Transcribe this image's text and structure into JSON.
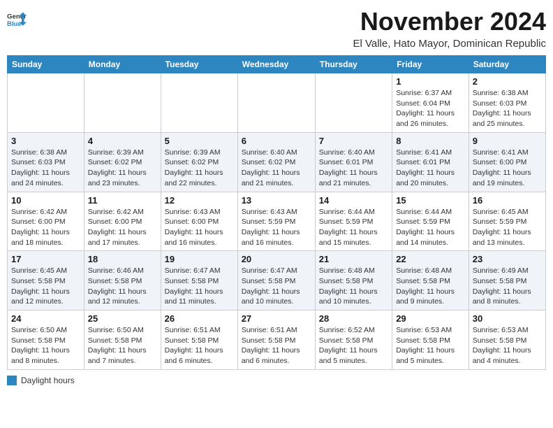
{
  "header": {
    "logo_line1": "General",
    "logo_line2": "Blue",
    "month": "November 2024",
    "location": "El Valle, Hato Mayor, Dominican Republic"
  },
  "days_of_week": [
    "Sunday",
    "Monday",
    "Tuesday",
    "Wednesday",
    "Thursday",
    "Friday",
    "Saturday"
  ],
  "weeks": [
    {
      "cells": [
        {
          "day": null,
          "info": null
        },
        {
          "day": null,
          "info": null
        },
        {
          "day": null,
          "info": null
        },
        {
          "day": null,
          "info": null
        },
        {
          "day": null,
          "info": null
        },
        {
          "day": "1",
          "info": "Sunrise: 6:37 AM\nSunset: 6:04 PM\nDaylight: 11 hours and 26 minutes."
        },
        {
          "day": "2",
          "info": "Sunrise: 6:38 AM\nSunset: 6:03 PM\nDaylight: 11 hours and 25 minutes."
        }
      ]
    },
    {
      "cells": [
        {
          "day": "3",
          "info": "Sunrise: 6:38 AM\nSunset: 6:03 PM\nDaylight: 11 hours and 24 minutes."
        },
        {
          "day": "4",
          "info": "Sunrise: 6:39 AM\nSunset: 6:02 PM\nDaylight: 11 hours and 23 minutes."
        },
        {
          "day": "5",
          "info": "Sunrise: 6:39 AM\nSunset: 6:02 PM\nDaylight: 11 hours and 22 minutes."
        },
        {
          "day": "6",
          "info": "Sunrise: 6:40 AM\nSunset: 6:02 PM\nDaylight: 11 hours and 21 minutes."
        },
        {
          "day": "7",
          "info": "Sunrise: 6:40 AM\nSunset: 6:01 PM\nDaylight: 11 hours and 21 minutes."
        },
        {
          "day": "8",
          "info": "Sunrise: 6:41 AM\nSunset: 6:01 PM\nDaylight: 11 hours and 20 minutes."
        },
        {
          "day": "9",
          "info": "Sunrise: 6:41 AM\nSunset: 6:00 PM\nDaylight: 11 hours and 19 minutes."
        }
      ]
    },
    {
      "cells": [
        {
          "day": "10",
          "info": "Sunrise: 6:42 AM\nSunset: 6:00 PM\nDaylight: 11 hours and 18 minutes."
        },
        {
          "day": "11",
          "info": "Sunrise: 6:42 AM\nSunset: 6:00 PM\nDaylight: 11 hours and 17 minutes."
        },
        {
          "day": "12",
          "info": "Sunrise: 6:43 AM\nSunset: 6:00 PM\nDaylight: 11 hours and 16 minutes."
        },
        {
          "day": "13",
          "info": "Sunrise: 6:43 AM\nSunset: 5:59 PM\nDaylight: 11 hours and 16 minutes."
        },
        {
          "day": "14",
          "info": "Sunrise: 6:44 AM\nSunset: 5:59 PM\nDaylight: 11 hours and 15 minutes."
        },
        {
          "day": "15",
          "info": "Sunrise: 6:44 AM\nSunset: 5:59 PM\nDaylight: 11 hours and 14 minutes."
        },
        {
          "day": "16",
          "info": "Sunrise: 6:45 AM\nSunset: 5:59 PM\nDaylight: 11 hours and 13 minutes."
        }
      ]
    },
    {
      "cells": [
        {
          "day": "17",
          "info": "Sunrise: 6:45 AM\nSunset: 5:58 PM\nDaylight: 11 hours and 12 minutes."
        },
        {
          "day": "18",
          "info": "Sunrise: 6:46 AM\nSunset: 5:58 PM\nDaylight: 11 hours and 12 minutes."
        },
        {
          "day": "19",
          "info": "Sunrise: 6:47 AM\nSunset: 5:58 PM\nDaylight: 11 hours and 11 minutes."
        },
        {
          "day": "20",
          "info": "Sunrise: 6:47 AM\nSunset: 5:58 PM\nDaylight: 11 hours and 10 minutes."
        },
        {
          "day": "21",
          "info": "Sunrise: 6:48 AM\nSunset: 5:58 PM\nDaylight: 11 hours and 10 minutes."
        },
        {
          "day": "22",
          "info": "Sunrise: 6:48 AM\nSunset: 5:58 PM\nDaylight: 11 hours and 9 minutes."
        },
        {
          "day": "23",
          "info": "Sunrise: 6:49 AM\nSunset: 5:58 PM\nDaylight: 11 hours and 8 minutes."
        }
      ]
    },
    {
      "cells": [
        {
          "day": "24",
          "info": "Sunrise: 6:50 AM\nSunset: 5:58 PM\nDaylight: 11 hours and 8 minutes."
        },
        {
          "day": "25",
          "info": "Sunrise: 6:50 AM\nSunset: 5:58 PM\nDaylight: 11 hours and 7 minutes."
        },
        {
          "day": "26",
          "info": "Sunrise: 6:51 AM\nSunset: 5:58 PM\nDaylight: 11 hours and 6 minutes."
        },
        {
          "day": "27",
          "info": "Sunrise: 6:51 AM\nSunset: 5:58 PM\nDaylight: 11 hours and 6 minutes."
        },
        {
          "day": "28",
          "info": "Sunrise: 6:52 AM\nSunset: 5:58 PM\nDaylight: 11 hours and 5 minutes."
        },
        {
          "day": "29",
          "info": "Sunrise: 6:53 AM\nSunset: 5:58 PM\nDaylight: 11 hours and 5 minutes."
        },
        {
          "day": "30",
          "info": "Sunrise: 6:53 AM\nSunset: 5:58 PM\nDaylight: 11 hours and 4 minutes."
        }
      ]
    }
  ],
  "legend": {
    "color_label": "Daylight hours"
  }
}
